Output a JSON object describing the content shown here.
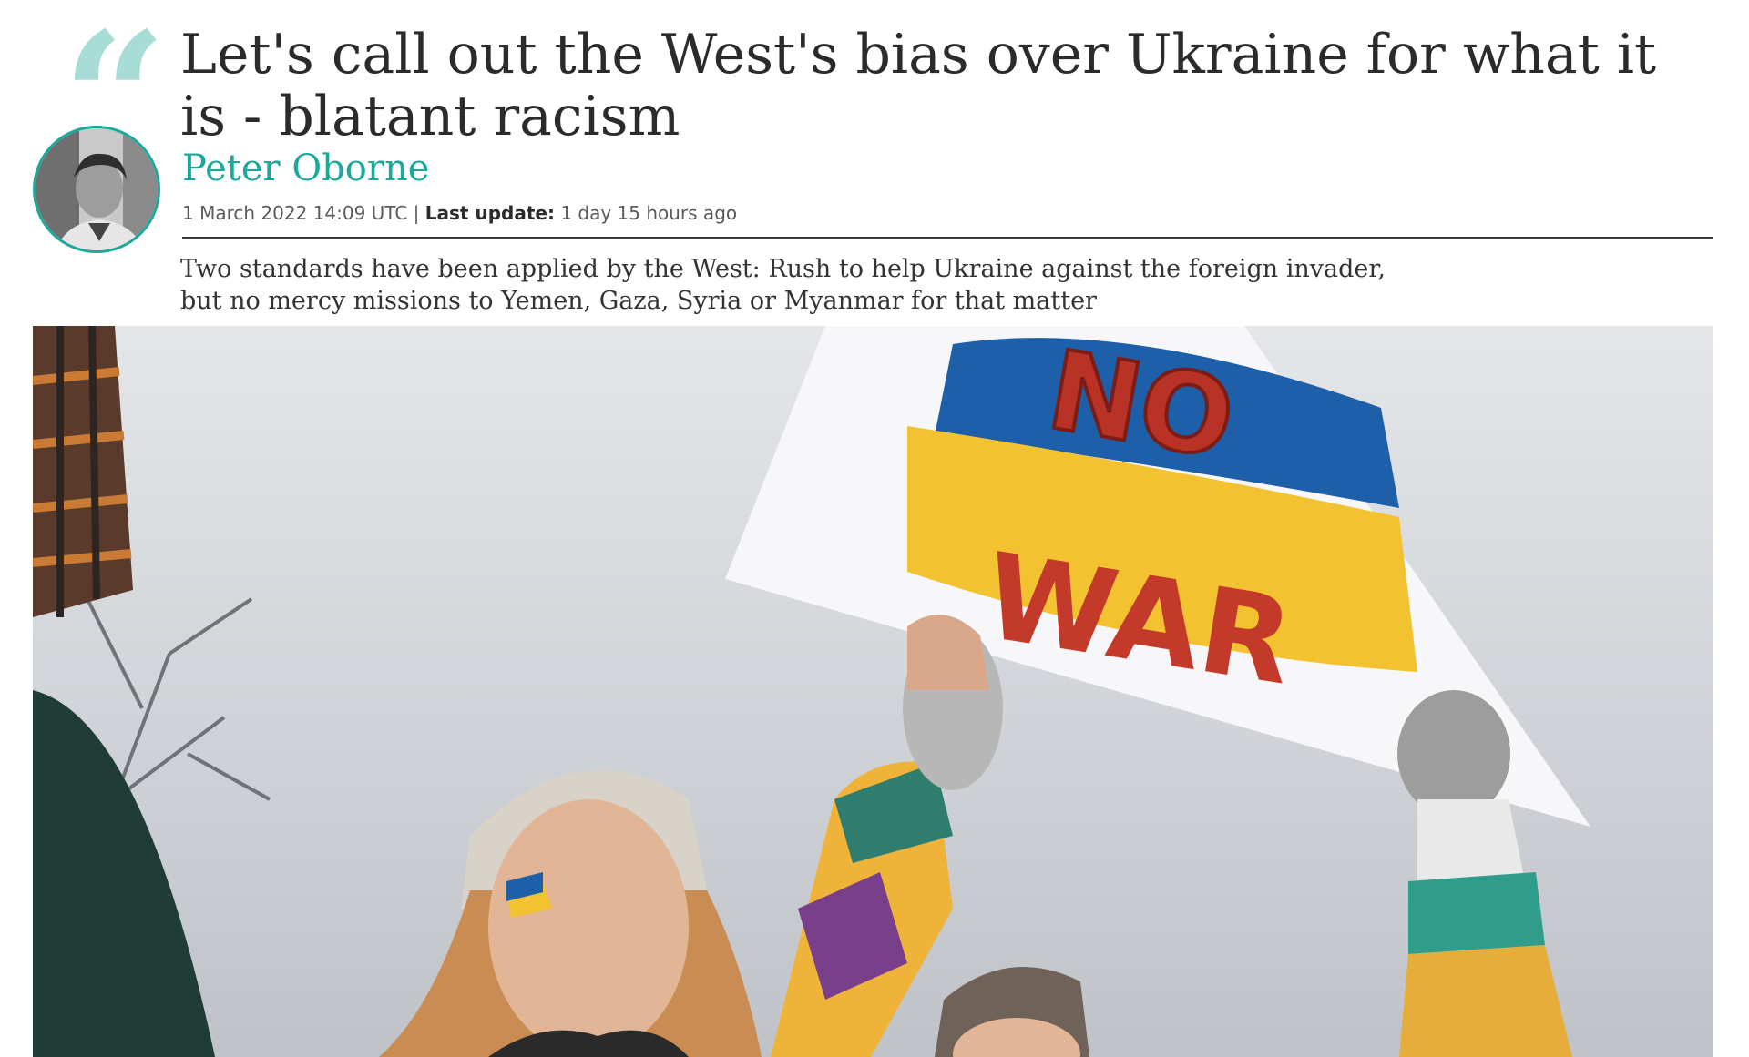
{
  "article": {
    "quote_glyph": "“",
    "headline": "Let's call out the West's bias over Ukraine for what it is - blatant racism",
    "author": "Peter Oborne",
    "published": "1 March 2022 14:09 UTC",
    "separator": "|",
    "last_update_label": "Last update:",
    "last_update_value": "1 day 15 hours ago",
    "standfirst": "Two standards have been applied by the West: Rush to help Ukraine against the foreign invader, but no mercy missions to Yemen, Gaza, Syria or Myanmar for that matter"
  },
  "hero_image": {
    "sign_line_1": "NO",
    "sign_line_2": "WAR"
  },
  "colors": {
    "accent": "#1aa99b",
    "quote": "#a8dcd6",
    "flag_blue": "#1d5fa8",
    "flag_yellow": "#f2c230",
    "sign_text": "#b83226"
  }
}
